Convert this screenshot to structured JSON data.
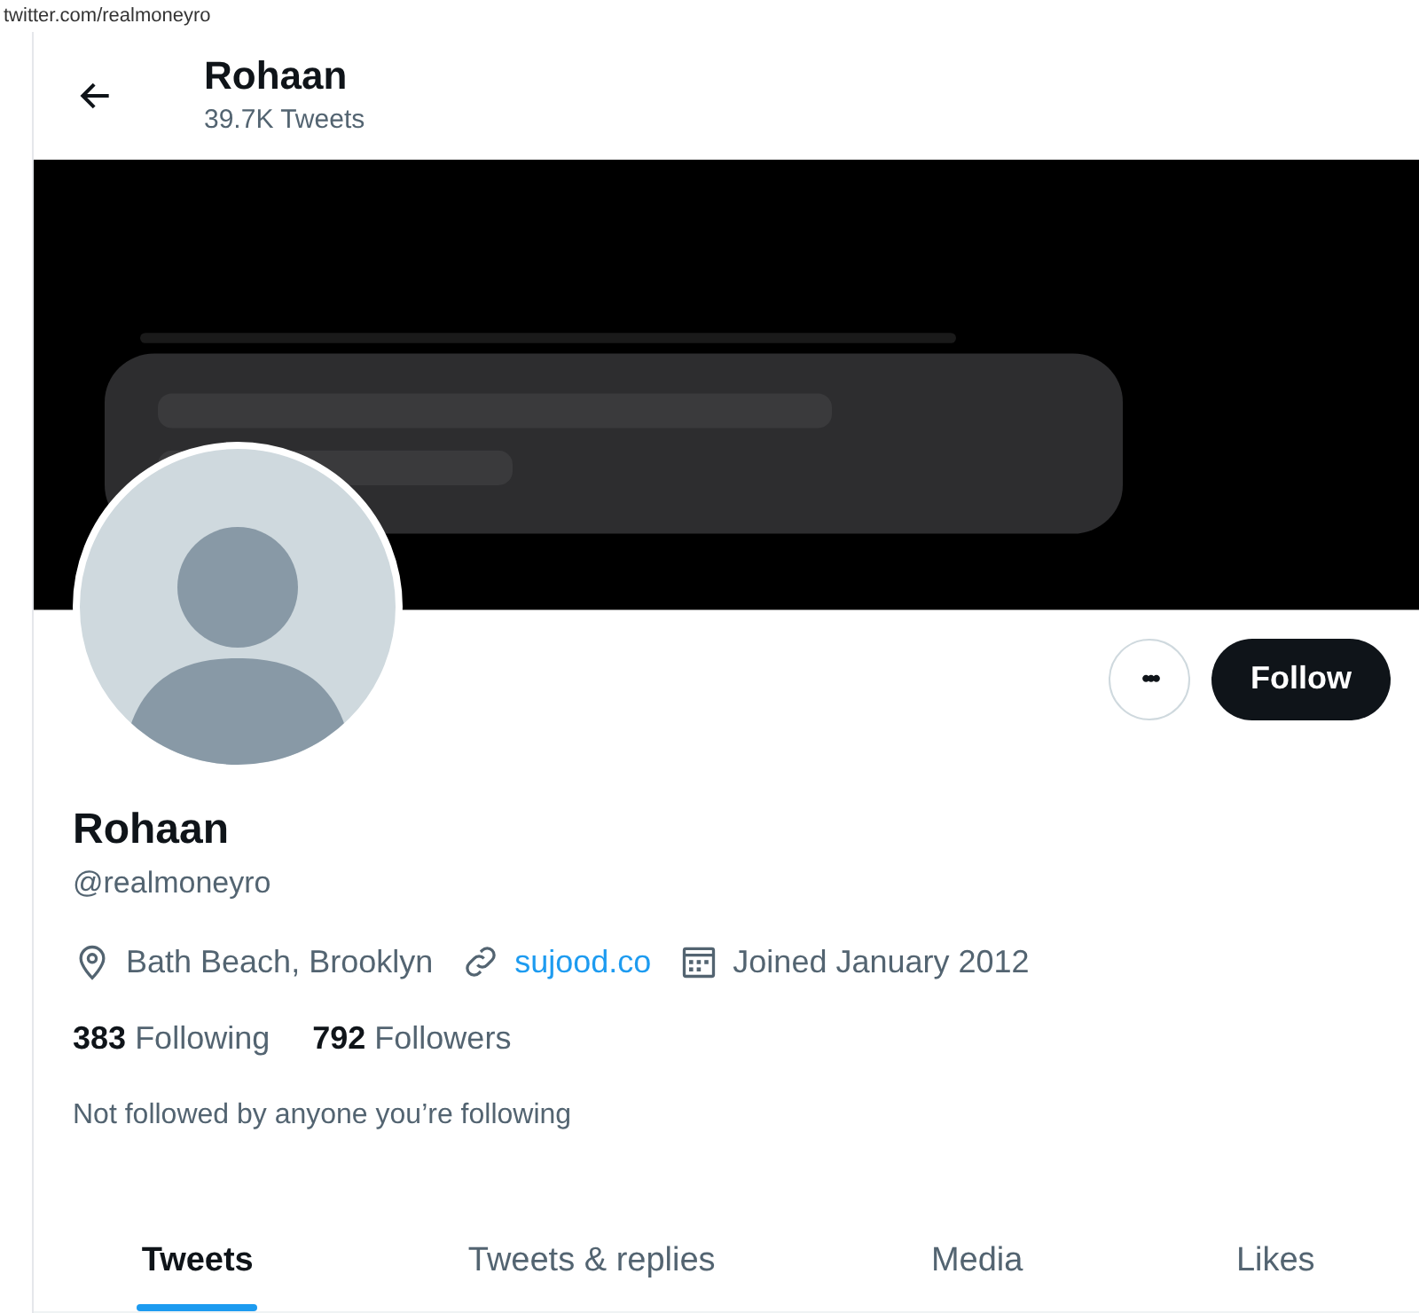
{
  "browser": {
    "url": "twitter.com/realmoneyro"
  },
  "header": {
    "name": "Rohaan",
    "tweet_count": "39.7K Tweets"
  },
  "actions": {
    "more": "•••",
    "follow": "Follow"
  },
  "profile": {
    "name": "Rohaan",
    "handle": "@realmoneyro",
    "location": "Bath Beach, Brooklyn",
    "website": "sujood.co",
    "joined": "Joined January 2012",
    "following_count": "383",
    "following_label": "Following",
    "followers_count": "792",
    "followers_label": "Followers",
    "social_context": "Not followed by anyone you’re following"
  },
  "tabs": [
    {
      "label": "Tweets",
      "selected": true
    },
    {
      "label": "Tweets & replies",
      "selected": false
    },
    {
      "label": "Media",
      "selected": false
    },
    {
      "label": "Likes",
      "selected": false
    }
  ]
}
